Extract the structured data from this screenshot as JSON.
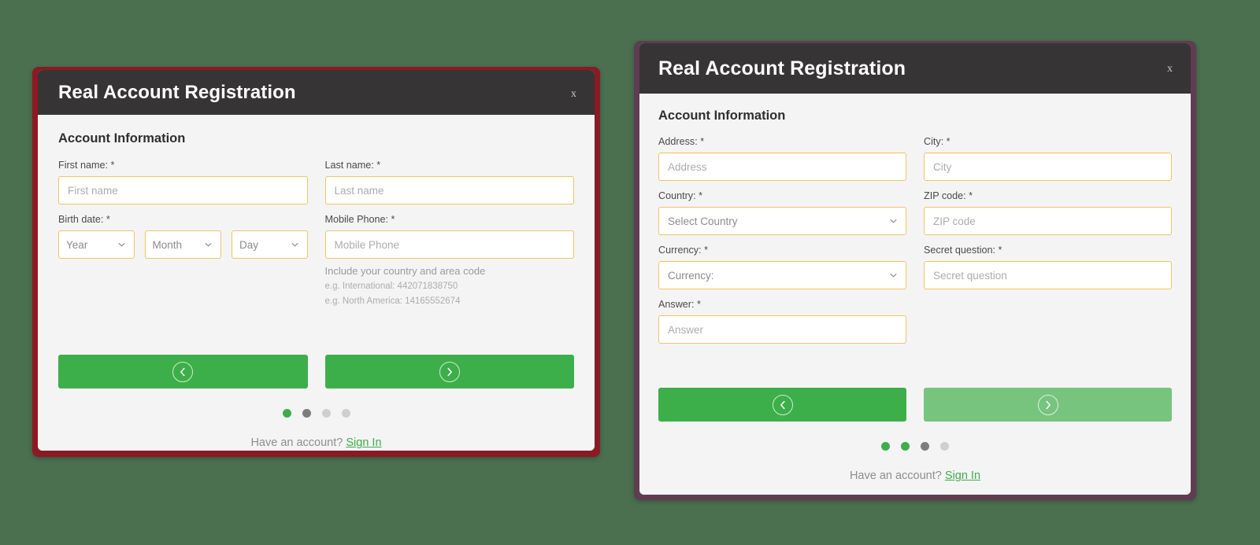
{
  "background_color": "#4A7050",
  "accent_green": "#3DAF4A",
  "input_border_color": "#F2C45E",
  "header_color": "#373435",
  "modal_left": {
    "frame_color": "#8B1A22",
    "title": "Real Account Registration",
    "close_label": "x",
    "section_title": "Account Information",
    "fields": {
      "first_name": {
        "label": "First name: *",
        "placeholder": "First name",
        "value": ""
      },
      "last_name": {
        "label": "Last name: *",
        "placeholder": "Last name",
        "value": ""
      },
      "birth_date": {
        "label": "Birth date: *",
        "year_placeholder": "Year",
        "month_placeholder": "Month",
        "day_placeholder": "Day"
      },
      "mobile_phone": {
        "label": "Mobile Phone: *",
        "placeholder": "Mobile Phone",
        "value": "",
        "hint_main": "Include your country and area code",
        "hint_international": "e.g. International: 442071838750",
        "hint_north_america": "e.g. North America: 14165552674"
      }
    },
    "nav": {
      "prev_icon": "chevron-left-circle-icon",
      "next_icon": "chevron-right-circle-icon"
    },
    "dots": [
      "active",
      "next",
      "inactive",
      "inactive"
    ],
    "signin_prompt": "Have an account?",
    "signin_link": "Sign In"
  },
  "modal_right": {
    "frame_color": "#5E3D52",
    "title": "Real Account Registration",
    "close_label": "x",
    "section_title": "Account Information",
    "fields": {
      "address": {
        "label": "Address: *",
        "placeholder": "Address",
        "value": ""
      },
      "city": {
        "label": "City: *",
        "placeholder": "City",
        "value": ""
      },
      "country": {
        "label": "Country: *",
        "placeholder": "Select Country",
        "value": ""
      },
      "zip_code": {
        "label": "ZIP code: *",
        "placeholder": "ZIP code",
        "value": ""
      },
      "currency": {
        "label": "Currency: *",
        "placeholder": "Currency:",
        "value": ""
      },
      "secret_question": {
        "label": "Secret question: *",
        "placeholder": "Secret question",
        "value": ""
      },
      "answer": {
        "label": "Answer: *",
        "placeholder": "Answer",
        "value": ""
      }
    },
    "nav": {
      "prev_icon": "chevron-left-circle-icon",
      "next_icon": "chevron-right-circle-icon"
    },
    "dots": [
      "past",
      "active",
      "next",
      "inactive"
    ],
    "signin_prompt": "Have an account?",
    "signin_link": "Sign In"
  }
}
